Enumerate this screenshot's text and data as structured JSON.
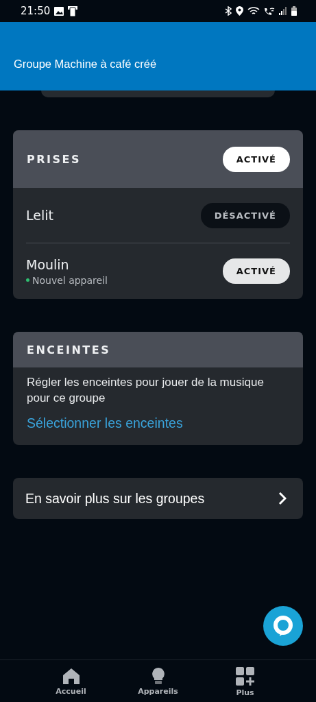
{
  "status_bar": {
    "time": "21:50"
  },
  "snackbar": {
    "message": "Groupe Machine à café créé"
  },
  "plugs": {
    "title": "PRISES",
    "toggle": {
      "label": "ACTIVÉ",
      "on": true
    },
    "devices": [
      {
        "name": "Lelit",
        "toggle": {
          "label": "DÉSACTIVÉ",
          "on": false
        }
      },
      {
        "name": "Moulin",
        "badge": {
          "text": "Nouvel appareil",
          "color": "#2fbf71"
        },
        "toggle": {
          "label": "ACTIVÉ",
          "on": true
        }
      }
    ]
  },
  "speakers": {
    "title": "ENCEINTES",
    "description": "Régler les enceintes pour jouer de la musique pour ce groupe",
    "link": "Sélectionner les enceintes"
  },
  "learn_more": {
    "label": "En savoir plus sur les groupes"
  },
  "bottom_nav": [
    {
      "kind": "home",
      "label": "Accueil"
    },
    {
      "kind": "devices",
      "label": "Appareils"
    },
    {
      "kind": "more",
      "label": "Plus"
    }
  ]
}
